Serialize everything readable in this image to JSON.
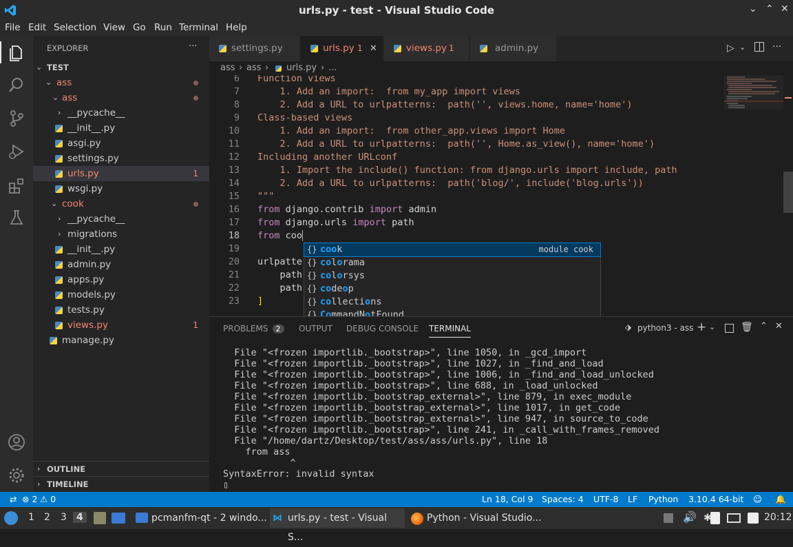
{
  "window": {
    "title": "urls.py - test - Visual Studio Code",
    "min": "⌄",
    "max": "⌃",
    "close": "✕"
  },
  "menu": [
    "File",
    "Edit",
    "Selection",
    "View",
    "Go",
    "Run",
    "Terminal",
    "Help"
  ],
  "explorer": {
    "title": "EXPLORER",
    "more": "···",
    "root": "TEST",
    "items": [
      {
        "label": "ass",
        "chev": "⌄"
      },
      {
        "label": "ass",
        "chev": "⌄"
      },
      {
        "label": "__pycache__",
        "chev": "›"
      },
      {
        "label": "__init__.py"
      },
      {
        "label": "asgi.py"
      },
      {
        "label": "settings.py"
      },
      {
        "label": "urls.py",
        "count": "1"
      },
      {
        "label": "wsgi.py"
      },
      {
        "label": "cook",
        "chev": "⌄"
      },
      {
        "label": "__pycache__",
        "chev": "›"
      },
      {
        "label": "migrations",
        "chev": "›"
      },
      {
        "label": "__init__.py"
      },
      {
        "label": "admin.py"
      },
      {
        "label": "apps.py"
      },
      {
        "label": "models.py"
      },
      {
        "label": "tests.py"
      },
      {
        "label": "views.py",
        "count": "1"
      },
      {
        "label": "manage.py"
      }
    ],
    "outline": "OUTLINE",
    "timeline": "TIMELINE"
  },
  "tabs": [
    {
      "label": "settings.py"
    },
    {
      "label": "urls.py",
      "count": "1",
      "close": "✕"
    },
    {
      "label": "views.py",
      "count": "1"
    },
    {
      "label": "admin.py"
    }
  ],
  "breadcrumb": [
    "ass",
    "›",
    "ass",
    "›",
    "urls.py",
    "›",
    "..."
  ],
  "code": [
    {
      "n": "6",
      "t": "Function views"
    },
    {
      "n": "7",
      "t": "    1. Add an import:  from my_app import views"
    },
    {
      "n": "8",
      "t": "    2. Add a URL to urlpatterns:  path('', views.home, name='home')"
    },
    {
      "n": "9",
      "t": "Class-based views"
    },
    {
      "n": "10",
      "t": "    1. Add an import:  from other_app.views import Home"
    },
    {
      "n": "11",
      "t": "    2. Add a URL to urlpatterns:  path('', Home.as_view(), name='home')"
    },
    {
      "n": "12",
      "t": "Including another URLconf"
    },
    {
      "n": "13",
      "t": "    1. Import the include() function: from django.urls import include, path"
    },
    {
      "n": "14",
      "t": "    2. Add a URL to urlpatterns:  path('blog/', include('blog.urls'))"
    },
    {
      "n": "15",
      "t": "\"\"\""
    },
    {
      "n": "16",
      "a": "from",
      "b": " django.contrib ",
      "c": "import",
      "d": " admin"
    },
    {
      "n": "17",
      "a": "from",
      "b": " django.urls ",
      "c": "import",
      "d": " path"
    },
    {
      "n": "18",
      "a": "from",
      "b": " coo",
      "c": "",
      "d": ""
    },
    {
      "n": "19",
      "t": ""
    },
    {
      "n": "20",
      "p": "urlpatte"
    },
    {
      "n": "21",
      "p": "    path"
    },
    {
      "n": "22",
      "p": "    path"
    },
    {
      "n": "23",
      "br": "]"
    }
  ],
  "suggestions": [
    {
      "icon": "{}",
      "pre": "",
      "hl": "coo",
      "post": "k",
      "detail": "module cook"
    },
    {
      "icon": "{}",
      "pre": "",
      "hl": "co",
      "post": "l",
      "hl2": "o",
      "post2": "rama"
    },
    {
      "icon": "{}",
      "pre": "",
      "hl": "co",
      "post": "l",
      "hl2": "o",
      "post2": "rsys"
    },
    {
      "icon": "{}",
      "pre": "",
      "hl": "co",
      "post": "de",
      "hl2": "o",
      "post2": "p"
    },
    {
      "icon": "{}",
      "pre": "",
      "hl": "co",
      "post": "llecti",
      "hl2": "o",
      "post2": "ns"
    },
    {
      "icon": "{}",
      "pre": "",
      "hl": "Co",
      "post": "mmandN",
      "hl2": "o",
      "post2": "tFound"
    }
  ],
  "panel": {
    "tabs": [
      "PROBLEMS",
      "OUTPUT",
      "DEBUG CONSOLE",
      "TERMINAL"
    ],
    "problems_count": "2",
    "terminal_name": "python3 - ass",
    "terminal_lines": "  File \"<frozen importlib._bootstrap>\", line 1050, in _gcd_import\n  File \"<frozen importlib._bootstrap>\", line 1027, in _find_and_load\n  File \"<frozen importlib._bootstrap>\", line 1006, in _find_and_load_unlocked\n  File \"<frozen importlib._bootstrap>\", line 688, in _load_unlocked\n  File \"<frozen importlib._bootstrap_external>\", line 879, in exec_module\n  File \"<frozen importlib._bootstrap_external>\", line 1017, in get_code\n  File \"<frozen importlib._bootstrap_external>\", line 947, in source_to_code\n  File \"<frozen importlib._bootstrap>\", line 241, in _call_with_frames_removed\n  File \"/home/dartz/Desktop/test/ass/ass/urls.py\", line 18\n    from ass\n            ^\nSyntaxError: invalid syntax\n▯"
  },
  "status": {
    "errors": "⊗ 2",
    "warnings": "⚠ 0",
    "position": "Ln 18, Col 9",
    "spaces": "Spaces: 4",
    "encoding": "UTF-8",
    "eol": "LF",
    "language": "Python",
    "interpreter": "3.10.4 64-bit"
  },
  "taskbar": {
    "workspaces": [
      "1",
      "2",
      "3",
      "4"
    ],
    "tasks": [
      {
        "label": "pcmanfm-qt - 2 windo..."
      },
      {
        "label": "urls.py - test - Visual S..."
      },
      {
        "label": "Python - Visual Studio..."
      }
    ],
    "clock": "20:12"
  },
  "colors": {
    "accent": "#007acc",
    "error": "#f48771",
    "string": "#ce9178",
    "keyword": "#c586c0"
  }
}
